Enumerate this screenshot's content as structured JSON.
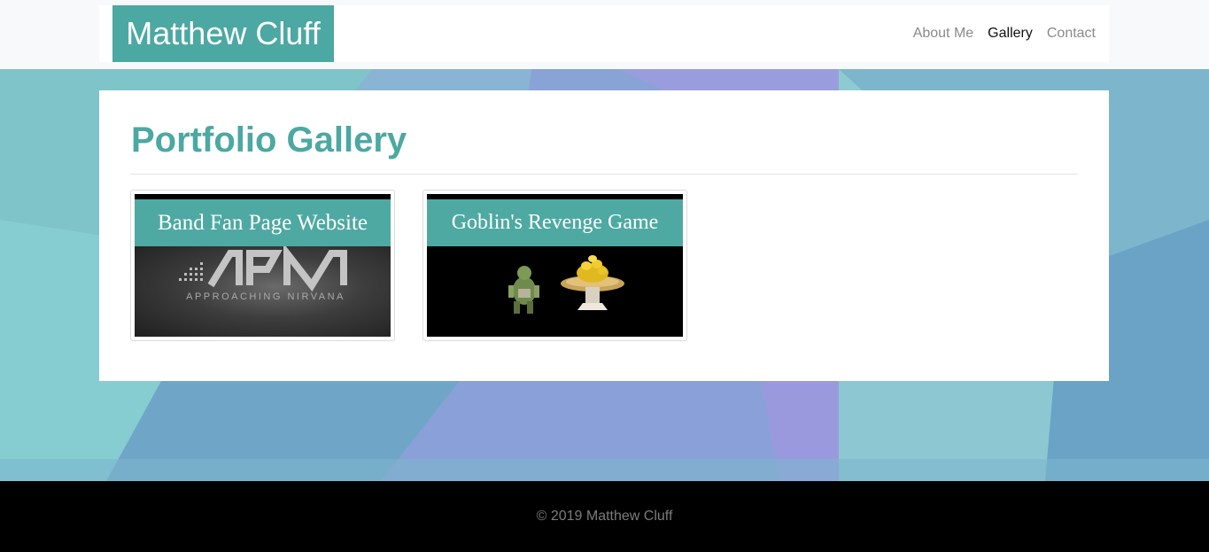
{
  "navbar": {
    "brand": "Matthew Cluff",
    "links": [
      {
        "label": "About Me",
        "active": false
      },
      {
        "label": "Gallery",
        "active": true
      },
      {
        "label": "Contact",
        "active": false
      }
    ]
  },
  "main": {
    "title": "Portfolio Gallery",
    "gallery": [
      {
        "banner": "Band Fan Page Website",
        "logo_text": "APPROACHING NIRVANA"
      },
      {
        "banner": "Goblin's Revenge Game"
      }
    ]
  },
  "footer": {
    "copyright": "© 2019 Matthew Cluff"
  },
  "colors": {
    "brand": "#4ca8a2",
    "footer_bg": "#000000"
  }
}
